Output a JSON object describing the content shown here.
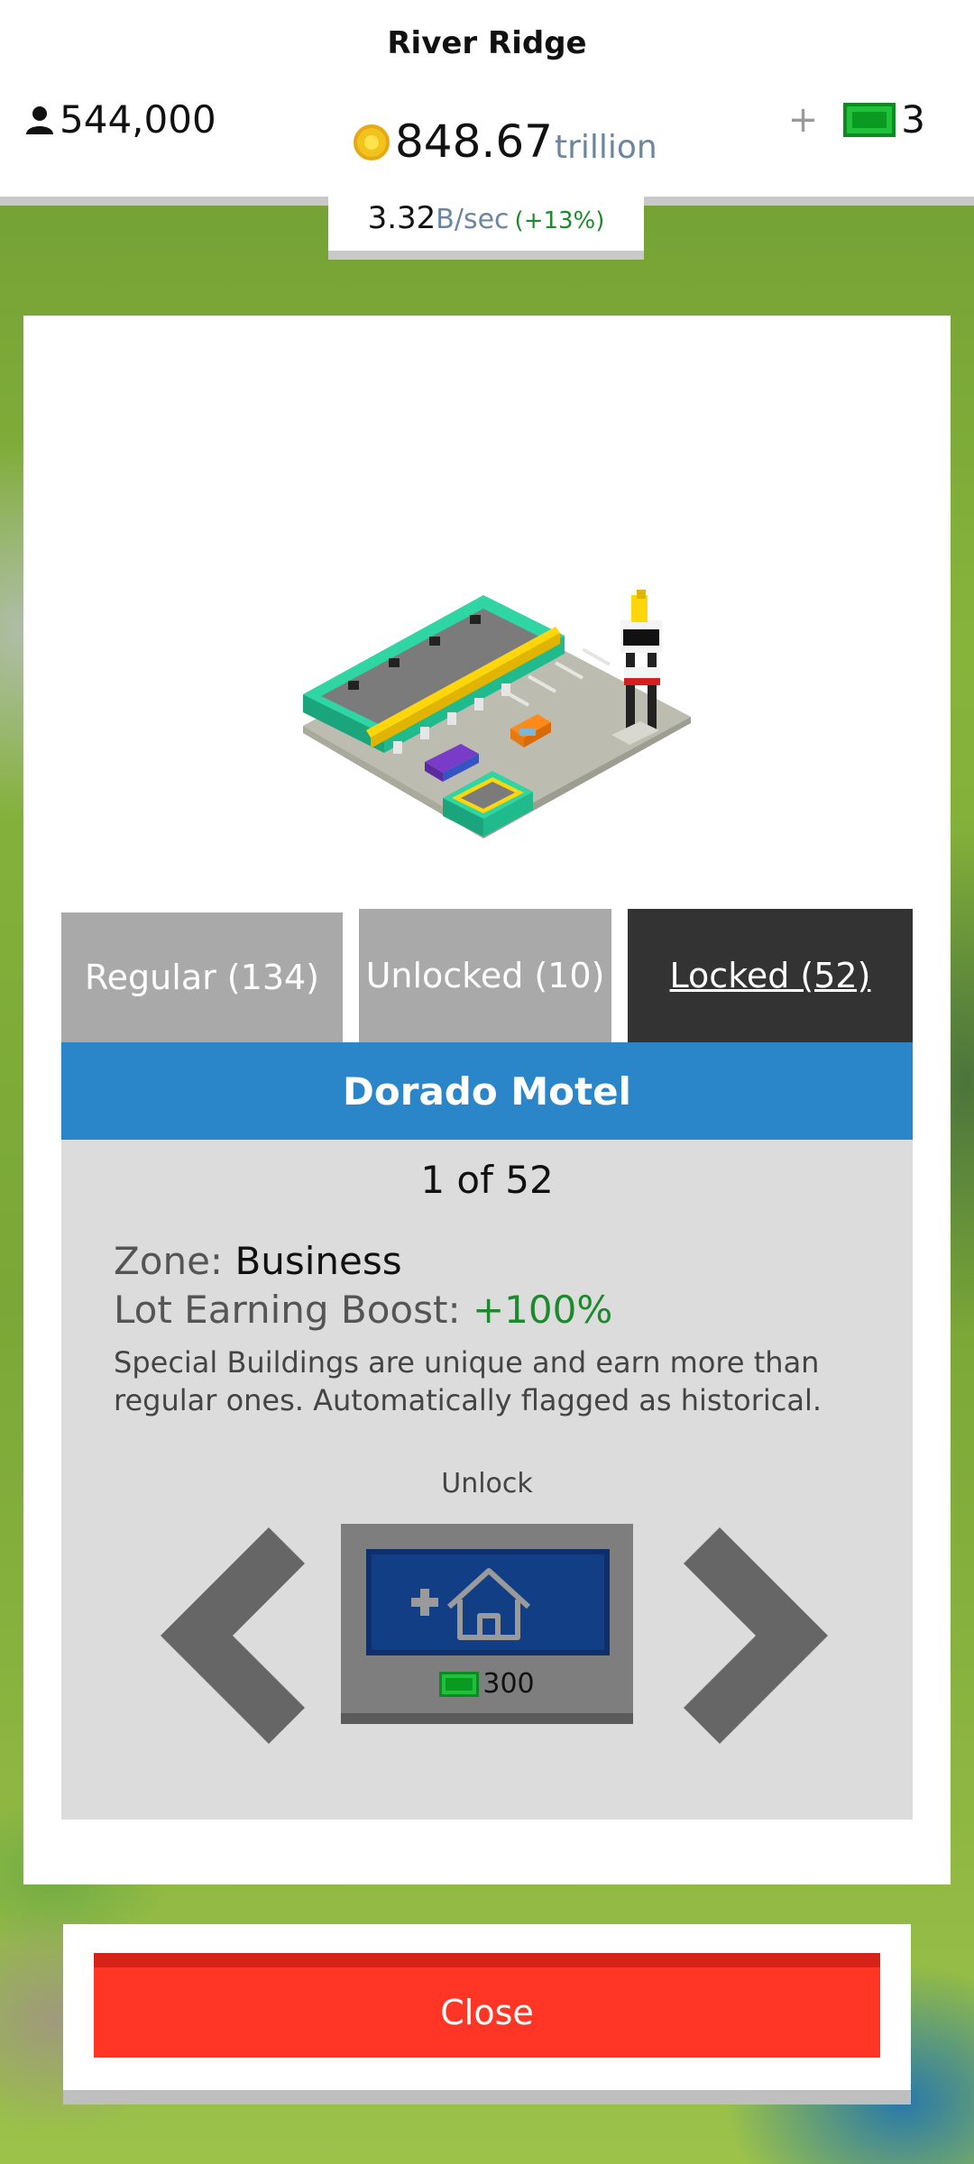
{
  "header": {
    "city_name": "River Ridge",
    "population": "544,000",
    "coins_value": "848.67",
    "coins_unit": "trillion",
    "cash_plus": "+",
    "cash_count": "3",
    "rate_value": "3.32",
    "rate_unit": "B/sec",
    "rate_change": "(+13%)"
  },
  "tabs": [
    {
      "label": "Regular (134)"
    },
    {
      "label": "Unlocked (10)"
    },
    {
      "label": "Locked (52)",
      "active": true
    }
  ],
  "building": {
    "name": "Dorado Motel",
    "counter": "1 of 52",
    "zone_label": "Zone: ",
    "zone_value": "Business",
    "boost_label": "Lot Earning Boost: ",
    "boost_value": "+100%",
    "description": "Special Buildings are unique and earn more than regular ones. Automatically flagged as historical."
  },
  "unlock": {
    "label": "Unlock",
    "price": "300"
  },
  "close_label": "Close",
  "colors": {
    "accent_blue": "#2a86c8",
    "close_red": "#ff3626",
    "boost_green": "#1c8a2c",
    "cash_green": "#1fc13a"
  },
  "icons": [
    "person-icon",
    "coin-icon",
    "cash-icon",
    "add-house-icon",
    "chevron-left-icon",
    "chevron-right-icon"
  ]
}
